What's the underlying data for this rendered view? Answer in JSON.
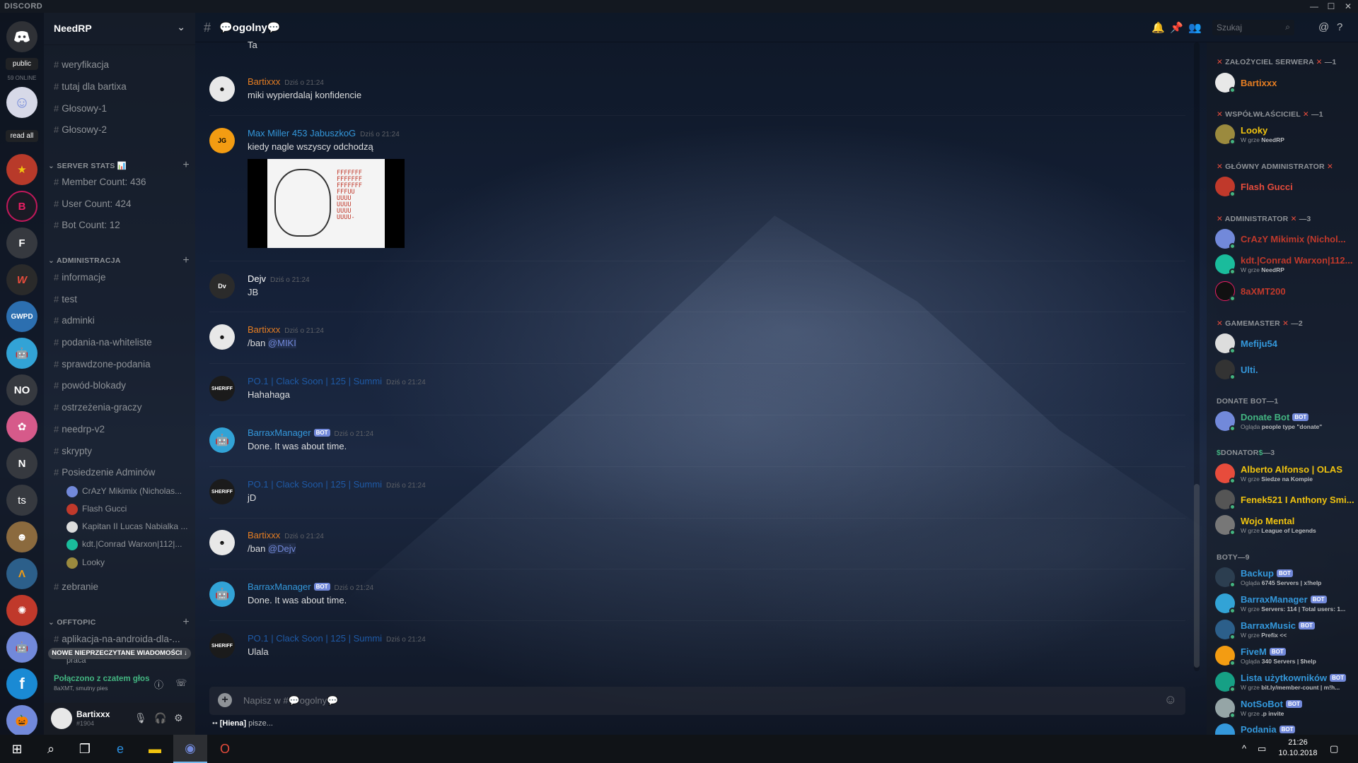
{
  "app": {
    "brand": "DISCORD",
    "window_controls": [
      "—",
      "☐",
      "✕"
    ]
  },
  "servers": {
    "public_label": "public",
    "online_label": "59 ONLINE",
    "read_all_label": "read all",
    "letters": [
      "F",
      "NO",
      "N",
      "ts"
    ]
  },
  "guild": {
    "name": "NeedRP",
    "channels_top": [
      "weryfikacja",
      "tutaj dla bartixa",
      "Głosowy-1",
      "Głosowy-2"
    ],
    "cat_stats": "SERVER STATS 📊",
    "stats_channels": [
      "Member Count: 436",
      "User Count: 424",
      "Bot Count: 12"
    ],
    "cat_admin": "ADMINISTRACJA",
    "admin_channels": [
      "informacje",
      "test",
      "adminki",
      "podania-na-whiteliste",
      "sprawdzone-podania",
      "powód-blokady",
      "ostrzeżenia-graczy",
      "needrp-v2",
      "skrypty",
      "Posiedzenie Adminów"
    ],
    "voice_users": [
      "CrAzY Mikimix (Nicholas...",
      "Flash Gucci",
      "Kapitan II Lucas Nabialka ...",
      "kdt.|Conrad Warxon|112|...",
      "Looky"
    ],
    "zebranie": "zebranie",
    "cat_offtopic": "OFFTOPIC",
    "offtopic_channels": [
      "aplikacja-na-androida-dla-...",
      "praca"
    ],
    "unread_bar": "NOWE NIEPRZECZYTANE WIADOMOŚCI ↓",
    "voice_connected": "Połączono z czatem głos",
    "voice_sub": "8aXMT, smutny pies"
  },
  "user": {
    "name": "Bartixxx",
    "tag": "#1904"
  },
  "chat": {
    "channel_title": "💬ogolny💬",
    "search_placeholder": "Szukaj",
    "partial_top": "Ta",
    "messages": [
      {
        "author": "Bartixxx",
        "ts": "Dziś o 21:24",
        "text": "miki wypierdalaj konfidencie",
        "color": "#e67e22",
        "bot": false
      },
      {
        "author": "Max Miller 453 JabuszkoG",
        "ts": "Dziś o 21:24",
        "text": "kiedy nagle wszyscy odchodzą",
        "color": "#3498db",
        "bot": false
      },
      {
        "author": "Dejv",
        "ts": "Dziś o 21:24",
        "text": "JB",
        "color": "#ffffff",
        "bot": false
      },
      {
        "author": "Bartixxx",
        "ts": "Dziś o 21:24",
        "text_prefix": "/ban ",
        "mention": "@MIKI",
        "color": "#e67e22",
        "bot": false
      },
      {
        "author": "PO.1 | Clack Soon | 125 | Summi",
        "ts": "Dziś o 21:24",
        "text": "Hahahaga",
        "color": "#1f5aa6",
        "bot": false
      },
      {
        "author": "BarraxManager",
        "ts": "Dziś o 21:24",
        "text": "Done. It was about time.",
        "color": "#3498db",
        "bot": true
      },
      {
        "author": "PO.1 | Clack Soon | 125 | Summi",
        "ts": "Dziś o 21:24",
        "text": "jD",
        "color": "#1f5aa6",
        "bot": false
      },
      {
        "author": "Bartixxx",
        "ts": "Dziś o 21:24",
        "text_prefix": "/ban ",
        "mention": "@Dejv",
        "color": "#e67e22",
        "bot": false
      },
      {
        "author": "BarraxManager",
        "ts": "Dziś o 21:24",
        "text": "Done. It was about time.",
        "color": "#3498db",
        "bot": true
      },
      {
        "author": "PO.1 | Clack Soon | 125 | Summi",
        "ts": "Dziś o 21:24",
        "text": "Ulala",
        "color": "#1f5aa6",
        "bot": false
      }
    ],
    "meme_text": "FFFFFFF\nFFFFFFF\nFFFFFFF\nFFFUU\nUUUU\nUUUU\nUUUU\nUUUU-",
    "composer_placeholder": "Napisz w #💬ogolny💬",
    "typing_user": "[Hiena]",
    "typing_suffix": " pisze...",
    "bot_badge": "BOT"
  },
  "members": {
    "roles": [
      {
        "label": "ZAŁOŻYCIEL SERWERA",
        "count": "—1"
      },
      {
        "label": "WSPÓŁWŁAŚCICIEL",
        "count": "—1"
      },
      {
        "label": "GŁÓWNY ADMINISTRATOR",
        "count": ""
      },
      {
        "label": "ADMINISTRATOR",
        "count": "—3"
      },
      {
        "label": "GAMEMASTER",
        "count": "—2"
      },
      {
        "label": "DONATE BOT—1",
        "count": ""
      },
      {
        "label": "DONATOR",
        "count": "—3"
      },
      {
        "label": "BOTY—9",
        "count": ""
      }
    ],
    "list": [
      {
        "name": "Bartixxx",
        "sub": "",
        "color": "#e67e22"
      },
      {
        "name": "Looky",
        "sub": "W grze ",
        "sub_b": "NeedRP",
        "color": "#f1c40f"
      },
      {
        "name": "Flash Gucci",
        "sub": "",
        "color": "#e74c3c"
      },
      {
        "name": "CrAzY Mikimix (Nichol...",
        "sub": "",
        "color": "#c0392b"
      },
      {
        "name": "kdt.|Conrad Warxon|112...",
        "sub": "W grze ",
        "sub_b": "NeedRP",
        "color": "#c0392b"
      },
      {
        "name": "8aXMT200",
        "sub": "",
        "color": "#c0392b"
      },
      {
        "name": "Mefiju54",
        "sub": "",
        "color": "#3498db"
      },
      {
        "name": "Ulti.",
        "sub": "",
        "color": "#3498db"
      },
      {
        "name": "Donate Bot",
        "sub": "Ogląda ",
        "sub_b": "people type \"donate\"",
        "color": "#43b581",
        "bot": true
      },
      {
        "name": "Alberto Alfonso | OLAS",
        "sub": "W grze ",
        "sub_b": "Siedze na Kompie",
        "color": "#f1c40f"
      },
      {
        "name": "Fenek521 I Anthony Smi...",
        "sub": "",
        "color": "#f1c40f"
      },
      {
        "name": "Wojo Mental",
        "sub": "W grze ",
        "sub_b": "League of Legends",
        "color": "#f1c40f"
      },
      {
        "name": "Backup",
        "sub": "Ogląda ",
        "sub_b": "6745 Servers | x!help",
        "color": "#3498db",
        "bot": true
      },
      {
        "name": "BarraxManager",
        "sub": "W grze ",
        "sub_b": "Servers: 114 | Total users: 1...",
        "color": "#3498db",
        "bot": true
      },
      {
        "name": "BarraxMusic",
        "sub": "W grze ",
        "sub_b": "Prefix <<",
        "color": "#3498db",
        "bot": true
      },
      {
        "name": "FiveM",
        "sub": "Ogląda ",
        "sub_b": "340 Servers | $help",
        "color": "#3498db",
        "bot": true
      },
      {
        "name": "Lista użytkowników",
        "sub": "W grze ",
        "sub_b": "bit.ly/member-count | m!h...",
        "color": "#3498db",
        "bot": true
      },
      {
        "name": "NotSoBot",
        "sub": "W grze ",
        "sub_b": ".p invite",
        "color": "#3498db",
        "bot": true
      },
      {
        "name": "Podania",
        "sub": "",
        "color": "#3498db",
        "bot": true
      }
    ]
  },
  "taskbar": {
    "time": "21:26",
    "date": "10.10.2018"
  }
}
